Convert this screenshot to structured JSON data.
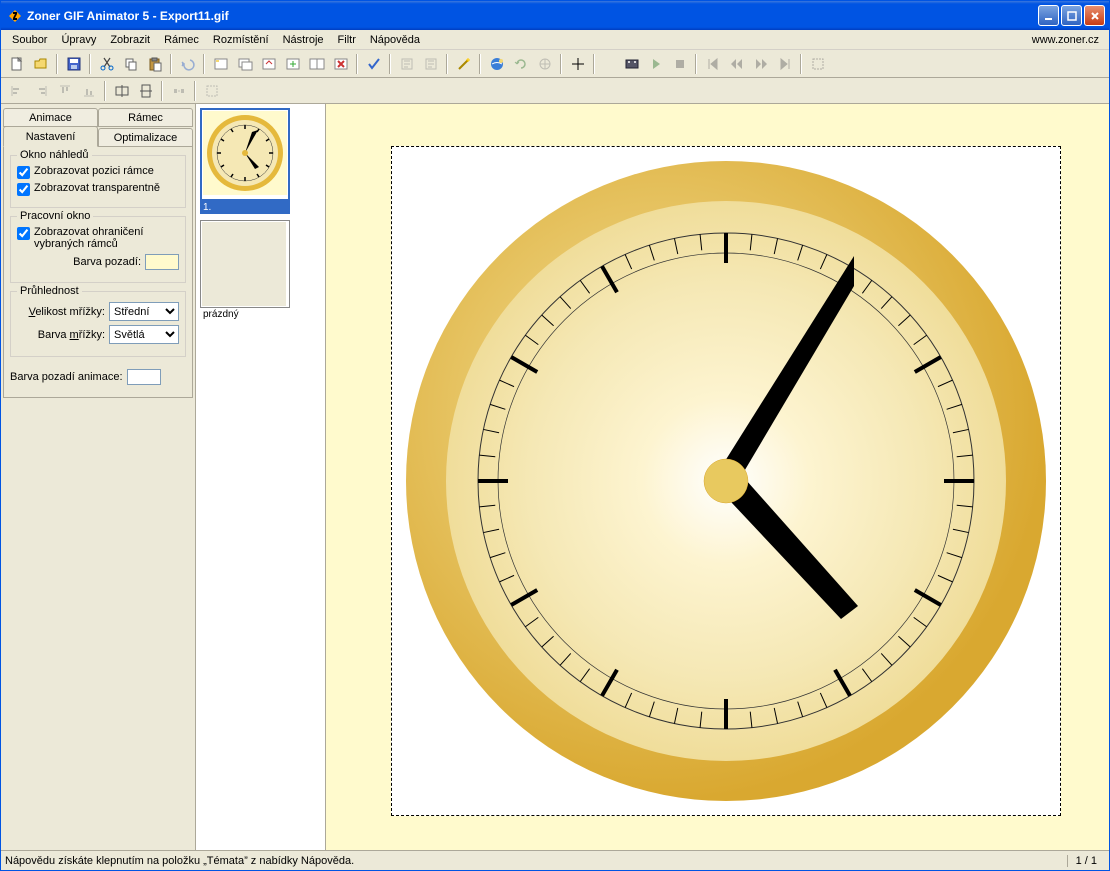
{
  "title": "Zoner GIF Animator 5 - Export11.gif",
  "url": "www.zoner.cz",
  "menu": [
    "Soubor",
    "Úpravy",
    "Zobrazit",
    "Rámec",
    "Rozmístění",
    "Nástroje",
    "Filtr",
    "Nápověda"
  ],
  "tabs": {
    "animace": "Animace",
    "ramec": "Rámec",
    "nastaveni": "Nastavení",
    "optimalizace": "Optimalizace"
  },
  "panel": {
    "okno_nahledu": "Okno náhledů",
    "zobrazovat_pozici": "Zobrazovat pozici rámce",
    "zobrazovat_transparentne": "Zobrazovat transparentně",
    "pracovni_okno": "Pracovní okno",
    "zobrazovat_ohraniceni": "Zobrazovat ohraničení vybraných rámců",
    "barva_pozadi": "Barva pozadí:",
    "pruhlednost": "Průhlednost",
    "velikost_mrizky": "Velikost mřížky:",
    "velikost_mrizky_val": "Střední",
    "barva_mrizky": "Barva mřížky:",
    "barva_mrizky_val": "Světlá",
    "barva_pozadi_animace": "Barva pozadí animace:"
  },
  "frames": {
    "f1": "1.",
    "empty": "prázdný"
  },
  "status": {
    "help": "Nápovědu získáte klepnutím na položku „Témata” z nabídky Nápověda.",
    "page": "1 / 1"
  }
}
